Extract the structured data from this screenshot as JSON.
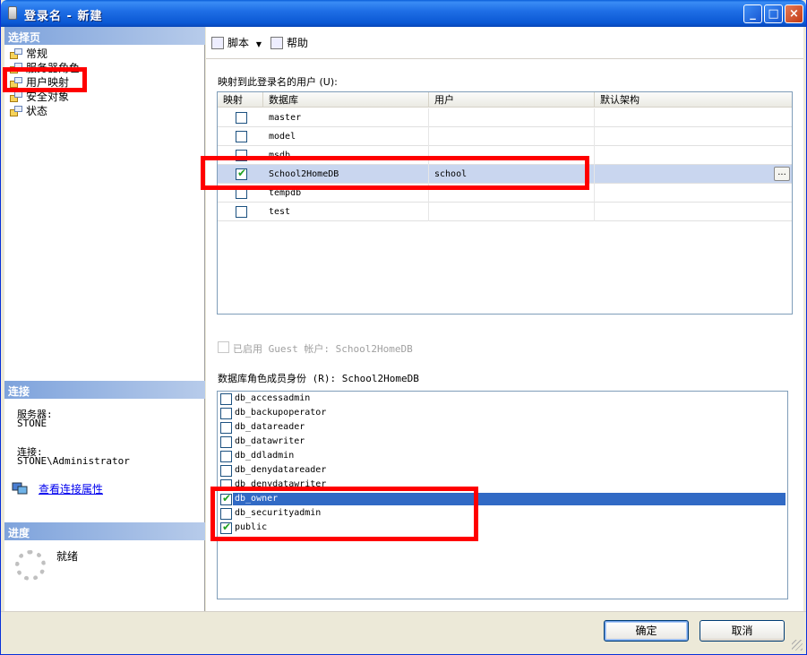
{
  "window": {
    "title": "登录名 - 新建"
  },
  "left": {
    "select_page_header": "选择页",
    "nav": [
      {
        "label": "常规"
      },
      {
        "label": "服务器角色"
      },
      {
        "label": "用户映射"
      },
      {
        "label": "安全对象"
      },
      {
        "label": "状态"
      }
    ],
    "connection_header": "连接",
    "server_label": "服务器:",
    "server_value": "STONE",
    "connection_label": "连接:",
    "connection_value": "STONE\\Administrator",
    "view_conn_props": "查看连接属性",
    "progress_header": "进度",
    "progress_status": "就绪"
  },
  "toolbar": {
    "script": "脚本",
    "help": "帮助"
  },
  "main": {
    "mapped_users_label": "映射到此登录名的用户 (U):",
    "columns": [
      "映射",
      "数据库",
      "用户",
      "默认架构"
    ],
    "rows": [
      {
        "checked": false,
        "db": "master",
        "user": "",
        "schema": ""
      },
      {
        "checked": false,
        "db": "model",
        "user": "",
        "schema": ""
      },
      {
        "checked": false,
        "db": "msdb",
        "user": "",
        "schema": ""
      },
      {
        "checked": true,
        "db": "School2HomeDB",
        "user": "school",
        "schema": ""
      },
      {
        "checked": false,
        "db": "tempdb",
        "user": "",
        "schema": ""
      },
      {
        "checked": false,
        "db": "test",
        "user": "",
        "schema": ""
      }
    ],
    "ellipsis": "...",
    "guest_label": "已启用 Guest 帐户: School2HomeDB",
    "role_membership_label": "数据库角色成员身份 (R): School2HomeDB",
    "roles": [
      {
        "name": "db_accessadmin",
        "checked": false
      },
      {
        "name": "db_backupoperator",
        "checked": false
      },
      {
        "name": "db_datareader",
        "checked": false
      },
      {
        "name": "db_datawriter",
        "checked": false
      },
      {
        "name": "db_ddladmin",
        "checked": false
      },
      {
        "name": "db_denydatareader",
        "checked": false
      },
      {
        "name": "db_denydatawriter",
        "checked": false
      },
      {
        "name": "db_owner",
        "checked": true
      },
      {
        "name": "db_securityadmin",
        "checked": false
      },
      {
        "name": "public",
        "checked": true
      }
    ]
  },
  "buttons": {
    "ok": "确定",
    "cancel": "取消"
  },
  "colors": {
    "highlight": "#ff0000",
    "selection": "#316ac5",
    "title_bar": "#0a5ed8"
  }
}
